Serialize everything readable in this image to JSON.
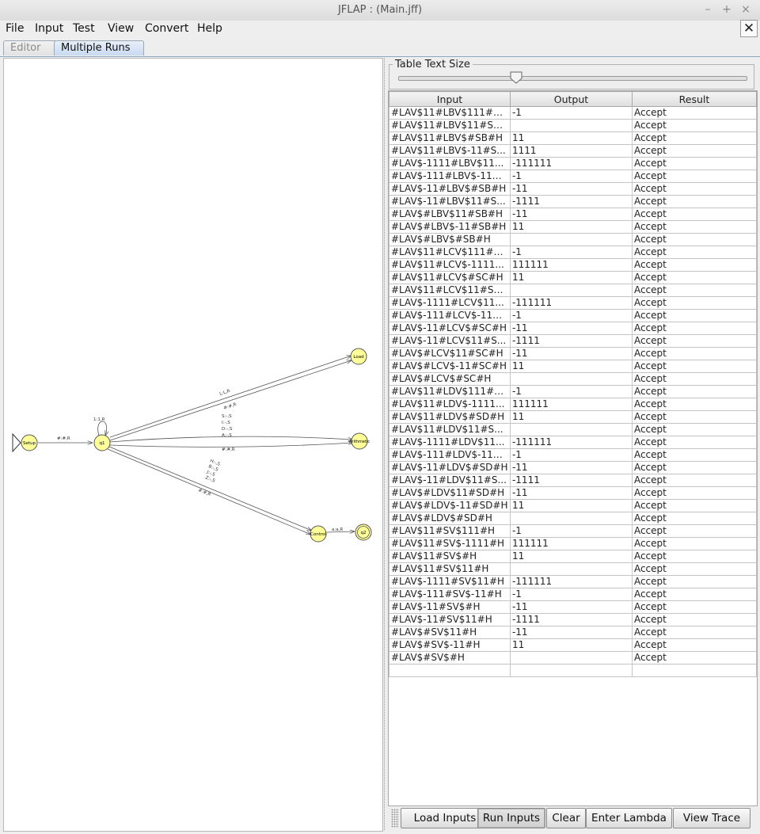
{
  "window": {
    "title": "JFLAP : (Main.jff)",
    "minimize_glyph": "–",
    "maximize_glyph": "+",
    "close_glyph": "×"
  },
  "menubar": {
    "items": [
      "File",
      "Input",
      "Test",
      "View",
      "Convert",
      "Help"
    ],
    "close_glyph": "✕"
  },
  "tabs": [
    {
      "label": "Editor",
      "active": false
    },
    {
      "label": "Multiple Runs",
      "active": true
    }
  ],
  "editor": {
    "states": [
      {
        "name": "Setup",
        "initial": true
      },
      {
        "name": "q1"
      },
      {
        "name": "Load"
      },
      {
        "name": "Arithmetic"
      },
      {
        "name": "Control"
      },
      {
        "name": "q2",
        "final": true
      }
    ],
    "transitions": {
      "setup_q1": "#:#,R",
      "q1_loop": "1:1,R",
      "q1_load_a": "L:L,R",
      "q1_load_b": "#:#,R",
      "q1_arith_a": "S:-,S",
      "q1_arith_b": "I:-,S",
      "q1_arith_c": "D:-,S",
      "q1_arith_d": "A:-,S",
      "q1_arith_e": "#:#,R",
      "q1_control_a": "H:-,S",
      "q1_control_b": "B:-,S",
      "q1_control_c": "J:-,S",
      "q1_control_d": "Z:-,S",
      "q1_control_e": "#:#,R",
      "control_q2": "a:a,R"
    }
  },
  "table_text_size": {
    "label": "Table Text Size",
    "level": 0.34
  },
  "table": {
    "headers": [
      "Input",
      "Output",
      "Result"
    ],
    "rows": [
      [
        "#LAV$11#LBV$111#S...",
        "-1",
        "Accept"
      ],
      [
        "#LAV$11#LBV$11#SB...",
        "",
        "Accept"
      ],
      [
        "#LAV$11#LBV$#SB#H",
        "11",
        "Accept"
      ],
      [
        "#LAV$11#LBV$-11#S...",
        "1111",
        "Accept"
      ],
      [
        "#LAV$-1111#LBV$11...",
        "-111111",
        "Accept"
      ],
      [
        "#LAV$-111#LBV$-11#...",
        "-1",
        "Accept"
      ],
      [
        "#LAV$-11#LBV$#SB#H",
        "-11",
        "Accept"
      ],
      [
        "#LAV$-11#LBV$11#S...",
        "-1111",
        "Accept"
      ],
      [
        "#LAV$#LBV$11#SB#H",
        "-11",
        "Accept"
      ],
      [
        "#LAV$#LBV$-11#SB#H",
        "11",
        "Accept"
      ],
      [
        "#LAV$#LBV$#SB#H",
        "",
        "Accept"
      ],
      [
        "#LAV$11#LCV$111#S...",
        "-1",
        "Accept"
      ],
      [
        "#LAV$11#LCV$-1111...",
        "111111",
        "Accept"
      ],
      [
        "#LAV$11#LCV$#SC#H",
        "11",
        "Accept"
      ],
      [
        "#LAV$11#LCV$11#SC...",
        "",
        "Accept"
      ],
      [
        "#LAV$-1111#LCV$11...",
        "-111111",
        "Accept"
      ],
      [
        "#LAV$-111#LCV$-11#...",
        "-1",
        "Accept"
      ],
      [
        "#LAV$-11#LCV$#SC#H",
        "-11",
        "Accept"
      ],
      [
        "#LAV$-11#LCV$11#S...",
        "-1111",
        "Accept"
      ],
      [
        "#LAV$#LCV$11#SC#H",
        "-11",
        "Accept"
      ],
      [
        "#LAV$#LCV$-11#SC#H",
        "11",
        "Accept"
      ],
      [
        "#LAV$#LCV$#SC#H",
        "",
        "Accept"
      ],
      [
        "#LAV$11#LDV$111#S...",
        "-1",
        "Accept"
      ],
      [
        "#LAV$11#LDV$-1111...",
        "111111",
        "Accept"
      ],
      [
        "#LAV$11#LDV$#SD#H",
        "11",
        "Accept"
      ],
      [
        "#LAV$11#LDV$11#S...",
        "",
        "Accept"
      ],
      [
        "#LAV$-1111#LDV$11...",
        "-111111",
        "Accept"
      ],
      [
        "#LAV$-111#LDV$-11#...",
        "-1",
        "Accept"
      ],
      [
        "#LAV$-11#LDV$#SD#H",
        "-11",
        "Accept"
      ],
      [
        "#LAV$-11#LDV$11#S...",
        "-1111",
        "Accept"
      ],
      [
        "#LAV$#LDV$11#SD#H",
        "-11",
        "Accept"
      ],
      [
        "#LAV$#LDV$-11#SD#H",
        "11",
        "Accept"
      ],
      [
        "#LAV$#LDV$#SD#H",
        "",
        "Accept"
      ],
      [
        "#LAV$11#SV$111#H",
        "-1",
        "Accept"
      ],
      [
        "#LAV$11#SV$-1111#H",
        "111111",
        "Accept"
      ],
      [
        "#LAV$11#SV$#H",
        "11",
        "Accept"
      ],
      [
        "#LAV$11#SV$11#H",
        "",
        "Accept"
      ],
      [
        "#LAV$-1111#SV$11#H",
        "-111111",
        "Accept"
      ],
      [
        "#LAV$-111#SV$-11#H",
        "-1",
        "Accept"
      ],
      [
        "#LAV$-11#SV$#H",
        "-11",
        "Accept"
      ],
      [
        "#LAV$-11#SV$11#H",
        "-1111",
        "Accept"
      ],
      [
        "#LAV$#SV$11#H",
        "-11",
        "Accept"
      ],
      [
        "#LAV$#SV$-11#H",
        "11",
        "Accept"
      ],
      [
        "#LAV$#SV$#H",
        "",
        "Accept"
      ],
      [
        "",
        "",
        ""
      ]
    ]
  },
  "buttons": {
    "load_inputs": "Load Inputs",
    "run_inputs": "Run Inputs",
    "clear": "Clear",
    "enter_lambda": "Enter Lambda",
    "view_trace": "View Trace"
  },
  "colors": {
    "state_fill": "#ffff99",
    "state_stroke": "#555555",
    "accent_tab": "#c9daf0"
  }
}
